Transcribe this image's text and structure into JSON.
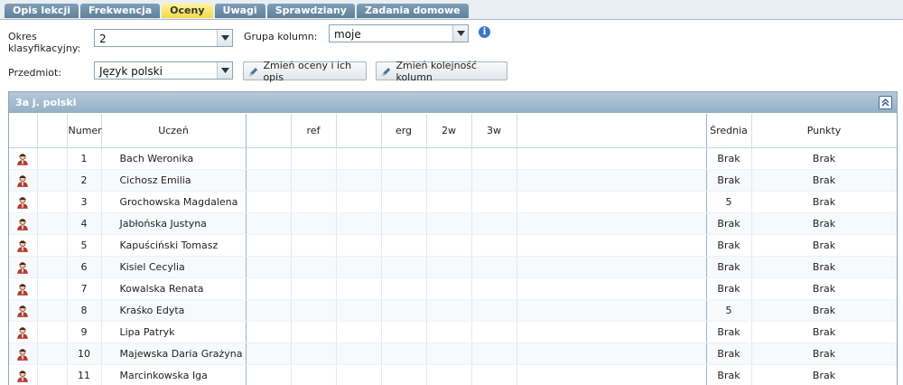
{
  "tabs": [
    {
      "label": "Opis lekcji",
      "active": false
    },
    {
      "label": "Frekwencja",
      "active": false
    },
    {
      "label": "Oceny",
      "active": true
    },
    {
      "label": "Uwagi",
      "active": false
    },
    {
      "label": "Sprawdziany",
      "active": false
    },
    {
      "label": "Zadania domowe",
      "active": false
    }
  ],
  "form": {
    "okres_label": "Okres klasyfikacyjny:",
    "okres_value": "2",
    "grupa_label": "Grupa kolumn:",
    "grupa_value": "moje",
    "przedmiot_label": "Przedmiot:",
    "przedmiot_value": "Język polski",
    "btn_zmien_oceny": "Zmień oceny i ich opis",
    "btn_zmien_kolejnosc": "Zmień kolejność kolumn"
  },
  "panel": {
    "title": "3a j. polski"
  },
  "table": {
    "headers": [
      "",
      "",
      "Numer",
      "Uczeń",
      "",
      "ref",
      "",
      "erg",
      "2w",
      "3w",
      "",
      "Średnia",
      "Punkty"
    ],
    "rows": [
      {
        "numer": "1",
        "uczen": "Bach Weronika",
        "srednia": "Brak",
        "punkty": "Brak"
      },
      {
        "numer": "2",
        "uczen": "Cichosz Emilia",
        "srednia": "Brak",
        "punkty": "Brak"
      },
      {
        "numer": "3",
        "uczen": "Grochowska Magdalena",
        "srednia": "5",
        "punkty": "Brak"
      },
      {
        "numer": "4",
        "uczen": "Jabłońska Justyna",
        "srednia": "Brak",
        "punkty": "Brak"
      },
      {
        "numer": "5",
        "uczen": "Kapuściński Tomasz",
        "srednia": "Brak",
        "punkty": "Brak"
      },
      {
        "numer": "6",
        "uczen": "Kisiel Cecylia",
        "srednia": "Brak",
        "punkty": "Brak"
      },
      {
        "numer": "7",
        "uczen": "Kowalska Renata",
        "srednia": "Brak",
        "punkty": "Brak"
      },
      {
        "numer": "8",
        "uczen": "Kraśko Edyta",
        "srednia": "5",
        "punkty": "Brak"
      },
      {
        "numer": "9",
        "uczen": "Lipa Patryk",
        "srednia": "Brak",
        "punkty": "Brak"
      },
      {
        "numer": "10",
        "uczen": "Majewska Daria Grażyna",
        "srednia": "Brak",
        "punkty": "Brak"
      },
      {
        "numer": "11",
        "uczen": "Marcinkowska Iga",
        "srednia": "Brak",
        "punkty": "Brak"
      }
    ]
  },
  "colors": {
    "tab_active": "#f3d94a",
    "tab": "#6f8fa8",
    "panel_head": "#a6bdd0",
    "user_icon": "#c0392b"
  }
}
